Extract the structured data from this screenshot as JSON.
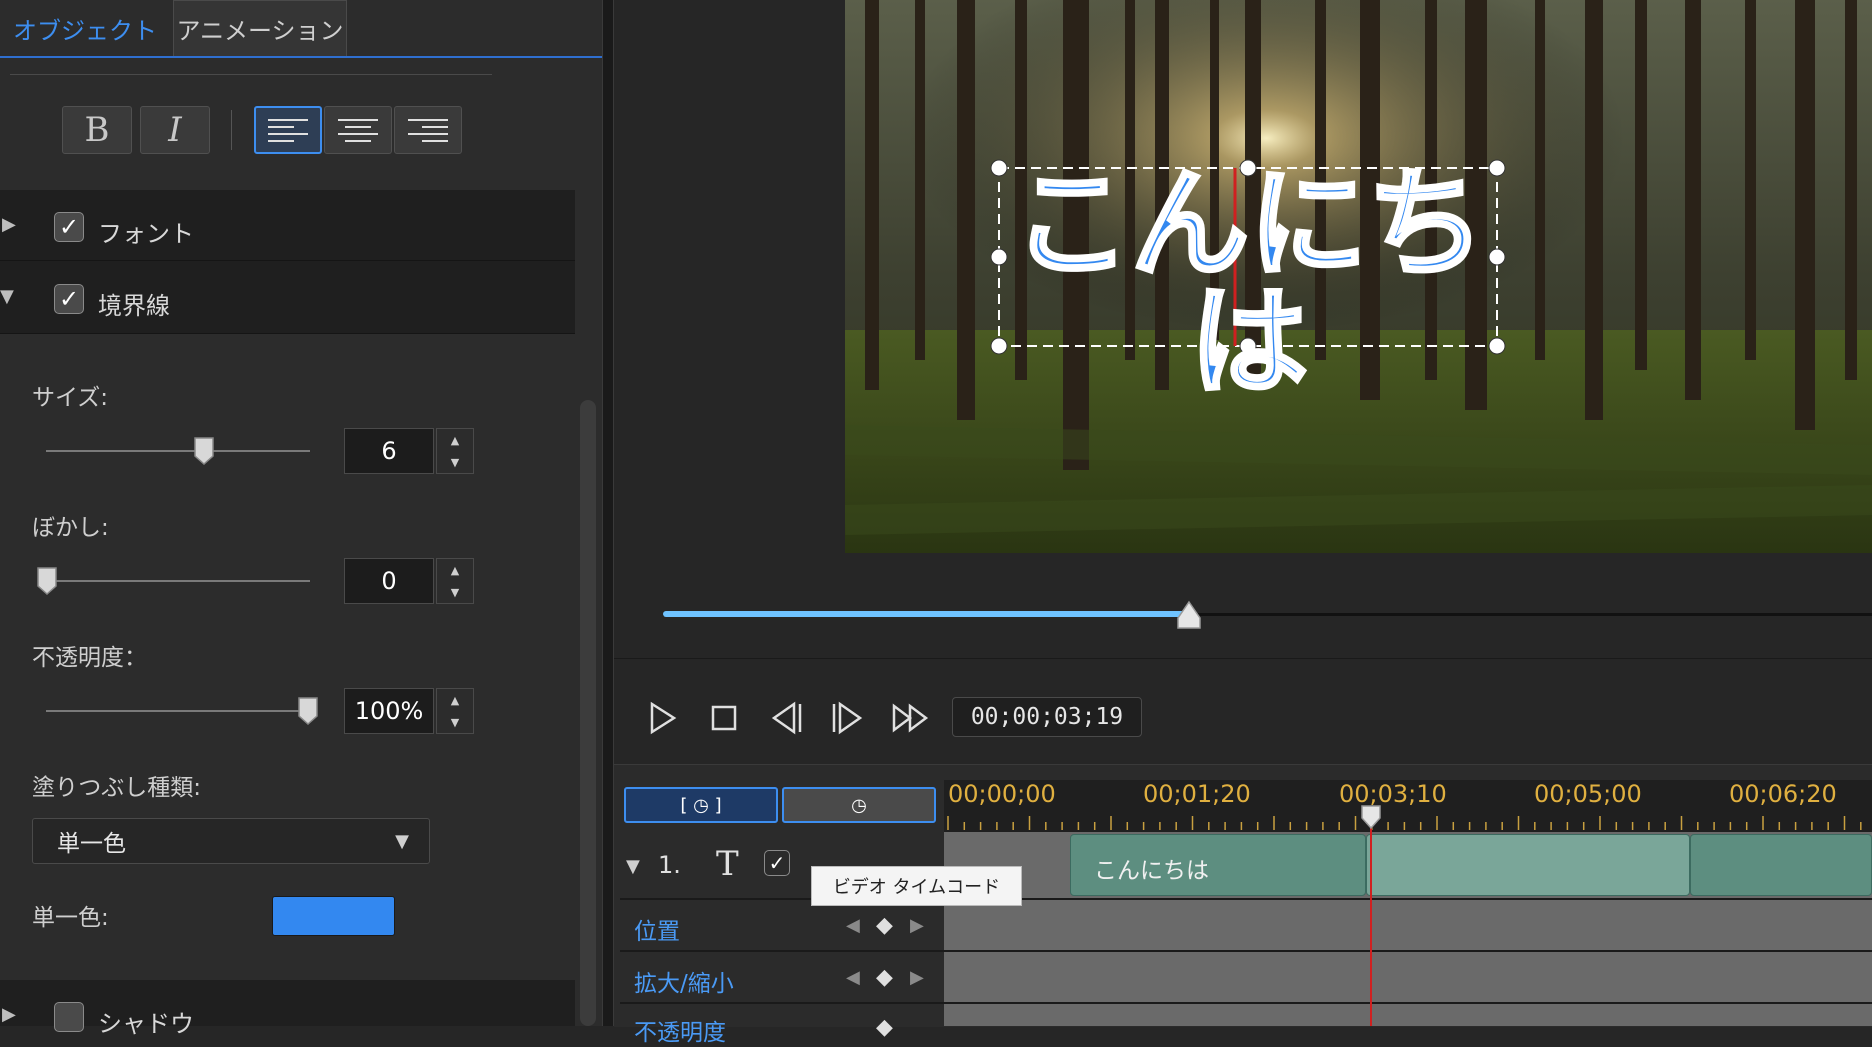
{
  "tabs": {
    "object": "オブジェクト",
    "animation": "アニメーション"
  },
  "format": {
    "bold": "B",
    "italic": "I"
  },
  "sections": {
    "font": {
      "label": "フォント",
      "checked": true,
      "expanded": false
    },
    "border": {
      "label": "境界線",
      "checked": true,
      "expanded": true
    },
    "shadow": {
      "label": "シャドウ",
      "checked": false,
      "expanded": false
    }
  },
  "border_props": {
    "size": {
      "label": "サイズ:",
      "value": "6",
      "slider_fraction": 0.6
    },
    "blur": {
      "label": "ぼかし:",
      "value": "0",
      "slider_fraction": 0.0
    },
    "opacity": {
      "label": "不透明度：",
      "value": "100%",
      "slider_fraction": 1.0
    },
    "fill_type": {
      "label": "塗りつぶし種類:",
      "selected": "単一色"
    },
    "solid_color": {
      "label": "単一色:",
      "color": "#3388f0"
    }
  },
  "preview": {
    "text": "こんにちは",
    "scrub_fraction": 0.43
  },
  "transport": {
    "timecode": "00;00;03;19"
  },
  "timeline": {
    "ruler_labels": [
      "00;00;00",
      "00;01;20",
      "00;03;10",
      "00;05;00",
      "00;06;20"
    ],
    "track_number": "1.",
    "track_type_icon": "T",
    "clip_label": "こんにちは",
    "rows": [
      "位置",
      "拡大/縮小",
      "不透明度"
    ],
    "tooltip": "ビデオ タイムコード"
  },
  "colors": {
    "accent": "#3d8ef0",
    "clip": "#5d8e80",
    "ruler_text": "#e0b040",
    "playhead": "#d02020"
  }
}
